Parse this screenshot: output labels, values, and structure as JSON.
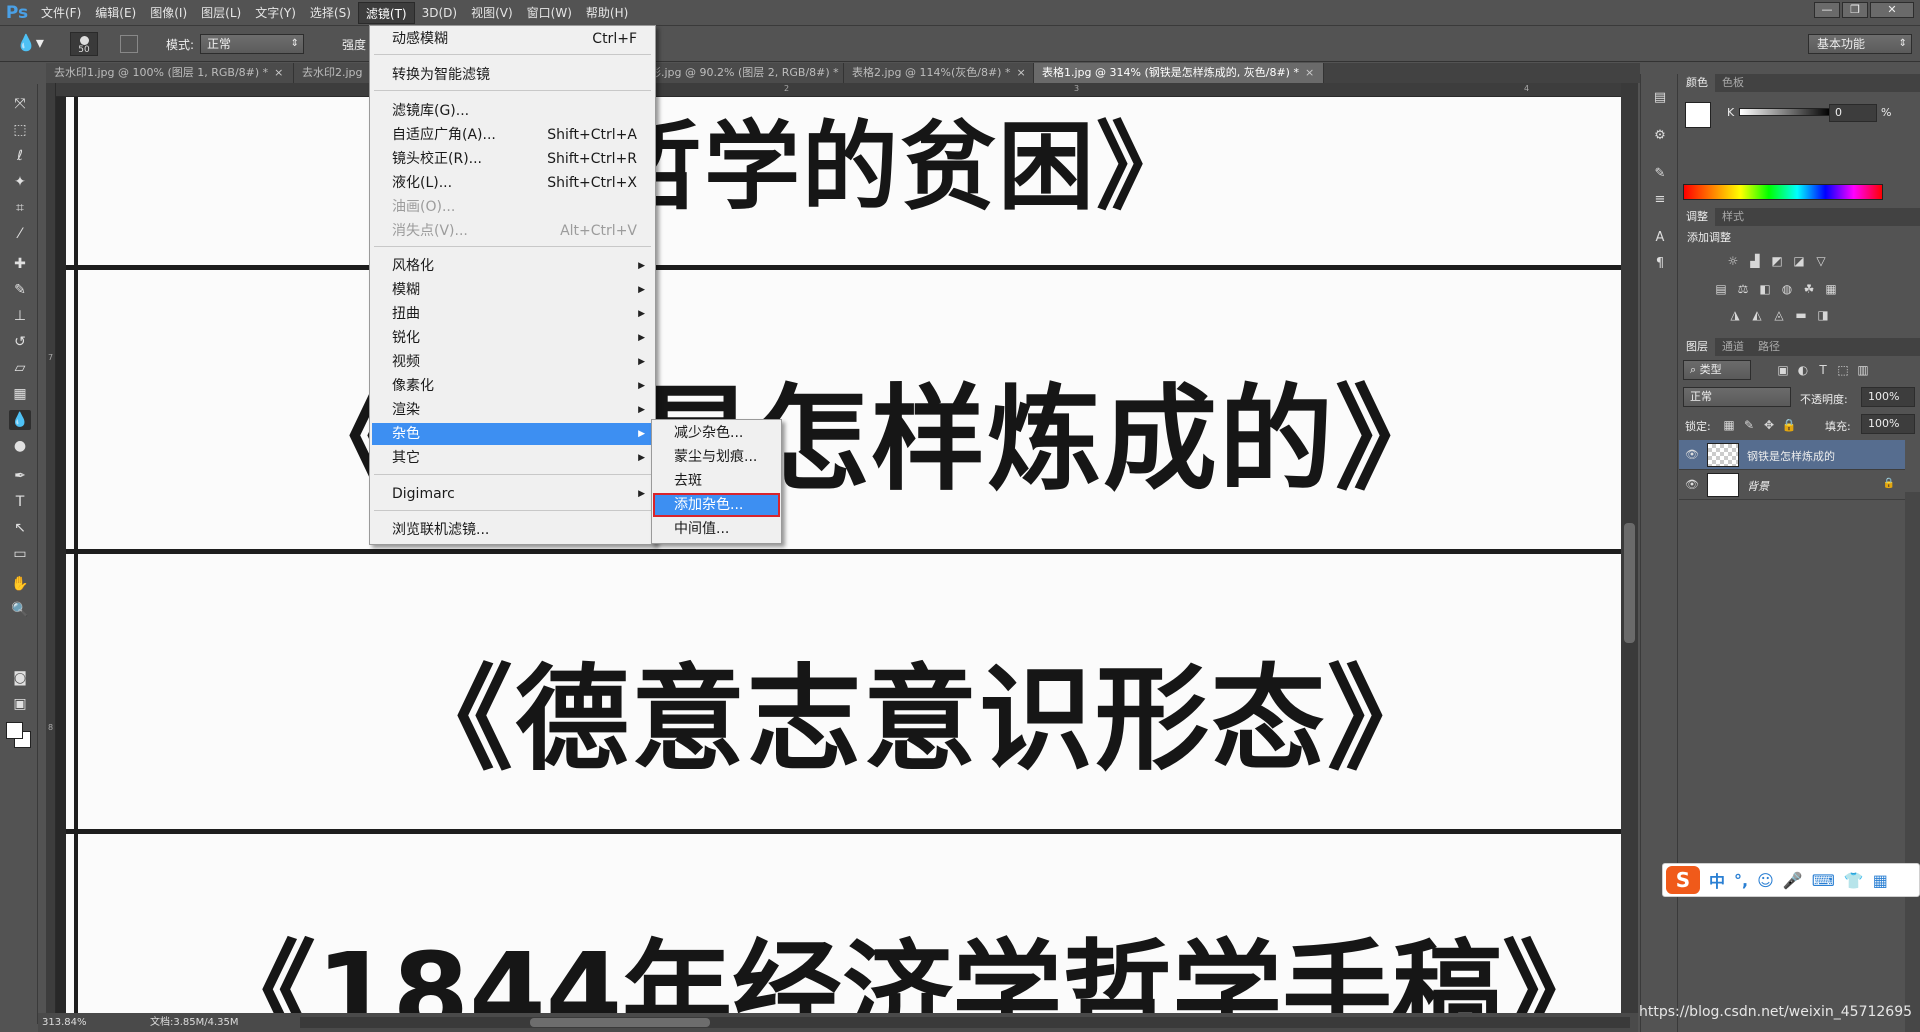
{
  "app": {
    "logo": "Ps"
  },
  "menubar": {
    "items": [
      "文件(F)",
      "编辑(E)",
      "图像(I)",
      "图层(L)",
      "文字(Y)",
      "选择(S)",
      "滤镜(T)",
      "3D(D)",
      "视图(V)",
      "窗口(W)",
      "帮助(H)"
    ],
    "active_index": 6
  },
  "window_controls": {
    "minimize": "—",
    "restore": "❐",
    "close": "✕"
  },
  "options_bar": {
    "brush_size": "50",
    "mode_label": "模式:",
    "mode_value": "正常",
    "strength_label": "强度",
    "workspace": "基本功能"
  },
  "tabs": [
    {
      "label": "去水印1.jpg @ 100% (图层 1, RGB/8#) *",
      "active": false
    },
    {
      "label": "去水印2.jpg",
      "active": false
    },
    {
      "label": "操控变形.jpg @ 90.2% (图层 2, RGB/8#) *",
      "active": false
    },
    {
      "label": "表格2.jpg @ 114%(灰色/8#) *",
      "active": false
    },
    {
      "label": "表格1.jpg @ 314% (钢铁是怎样炼成的, 灰色/8#) *",
      "active": true
    }
  ],
  "tab_close_glyph": "×",
  "rulers": {
    "top": [
      "2",
      "3",
      "4"
    ],
    "left": [
      "7",
      "8"
    ]
  },
  "document": {
    "lines": [
      "哲学的贫困》",
      "《钢铁是怎样炼成的》",
      "《德意志意识形态》",
      "《1844年经济学哲学手稿》"
    ]
  },
  "status": {
    "zoom": "313.84%",
    "docsize": "文档:3.85M/4.35M"
  },
  "filter_menu": {
    "items": [
      {
        "label": "动感模糊",
        "shortcut": "Ctrl+F"
      },
      {
        "label": "转换为智能滤镜",
        "shortcut": ""
      },
      {
        "label": "滤镜库(G)...",
        "shortcut": ""
      },
      {
        "label": "自适应广角(A)...",
        "shortcut": "Shift+Ctrl+A"
      },
      {
        "label": "镜头校正(R)...",
        "shortcut": "Shift+Ctrl+R"
      },
      {
        "label": "液化(L)...",
        "shortcut": "Shift+Ctrl+X"
      },
      {
        "label": "油画(O)...",
        "shortcut": ""
      },
      {
        "label": "消失点(V)...",
        "shortcut": "Alt+Ctrl+V"
      },
      {
        "label": "风格化",
        "shortcut": ""
      },
      {
        "label": "模糊",
        "shortcut": ""
      },
      {
        "label": "扭曲",
        "shortcut": ""
      },
      {
        "label": "锐化",
        "shortcut": ""
      },
      {
        "label": "视频",
        "shortcut": ""
      },
      {
        "label": "像素化",
        "shortcut": ""
      },
      {
        "label": "渲染",
        "shortcut": ""
      },
      {
        "label": "杂色",
        "shortcut": ""
      },
      {
        "label": "其它",
        "shortcut": ""
      },
      {
        "label": "Digimarc",
        "shortcut": ""
      },
      {
        "label": "浏览联机滤镜...",
        "shortcut": ""
      }
    ],
    "submenu_arrow": "▶"
  },
  "noise_menu": {
    "items": [
      "减少杂色...",
      "蒙尘与划痕...",
      "去斑",
      "添加杂色...",
      "中间值..."
    ]
  },
  "panels": {
    "color": {
      "tabs": [
        "颜色",
        "色板"
      ],
      "k_label": "K",
      "k_value": "0",
      "percent": "%"
    },
    "adjustments": {
      "tabs": [
        "调整",
        "样式"
      ],
      "title": "添加调整"
    },
    "layers": {
      "tabs": [
        "图层",
        "通道",
        "路径"
      ],
      "filter_kind": "类型",
      "blend_mode": "正常",
      "opacity_label": "不透明度:",
      "opacity_value": "100%",
      "lock_label": "锁定:",
      "fill_label": "填充:",
      "fill_value": "100%",
      "items": [
        {
          "name": "钢铁是怎样炼成的",
          "selected": true
        },
        {
          "name": "背景",
          "selected": false,
          "locked": true
        }
      ]
    }
  },
  "ime": {
    "logo": "S",
    "cells": [
      "中",
      "°,",
      "☺",
      "🎤",
      "⌨",
      "👕",
      "▦"
    ]
  },
  "watermark": "https://blog.csdn.net/weixin_45712695",
  "colors": {
    "menu_highlight": "#3d8ff2",
    "outline_red": "#d9242c",
    "layer_selected": "#566d8f"
  }
}
